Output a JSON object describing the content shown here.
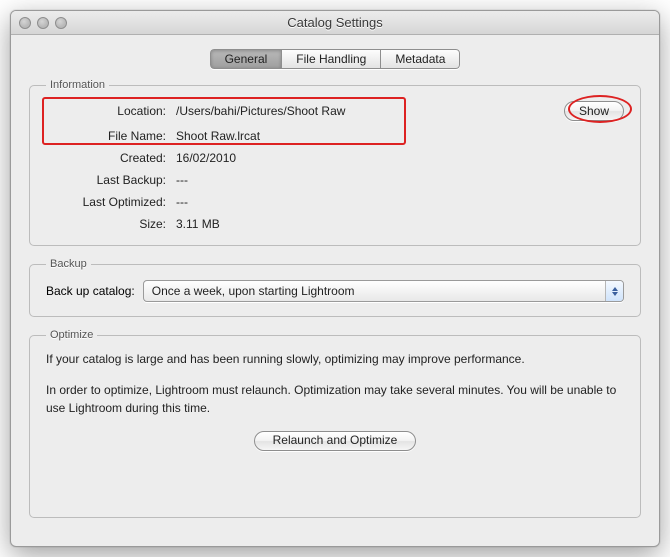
{
  "window": {
    "title": "Catalog Settings"
  },
  "tabs": {
    "general": "General",
    "file_handling": "File Handling",
    "metadata": "Metadata"
  },
  "groups": {
    "information": "Information",
    "backup": "Backup",
    "optimize": "Optimize"
  },
  "info": {
    "labels": {
      "location": "Location:",
      "file_name": "File Name:",
      "created": "Created:",
      "last_backup": "Last Backup:",
      "last_optimized": "Last Optimized:",
      "size": "Size:"
    },
    "values": {
      "location": "/Users/bahi/Pictures/Shoot Raw",
      "file_name": "Shoot Raw.lrcat",
      "created": "16/02/2010",
      "last_backup": "---",
      "last_optimized": "---",
      "size": "3.11 MB"
    },
    "show_button": "Show"
  },
  "backup": {
    "label": "Back up catalog:",
    "selected": "Once a week, upon starting Lightroom"
  },
  "optimize": {
    "p1": "If your catalog is large and has been running slowly, optimizing may improve performance.",
    "p2": "In order to optimize, Lightroom must relaunch. Optimization may take several minutes. You will be unable to use Lightroom during this time.",
    "button": "Relaunch and Optimize"
  }
}
